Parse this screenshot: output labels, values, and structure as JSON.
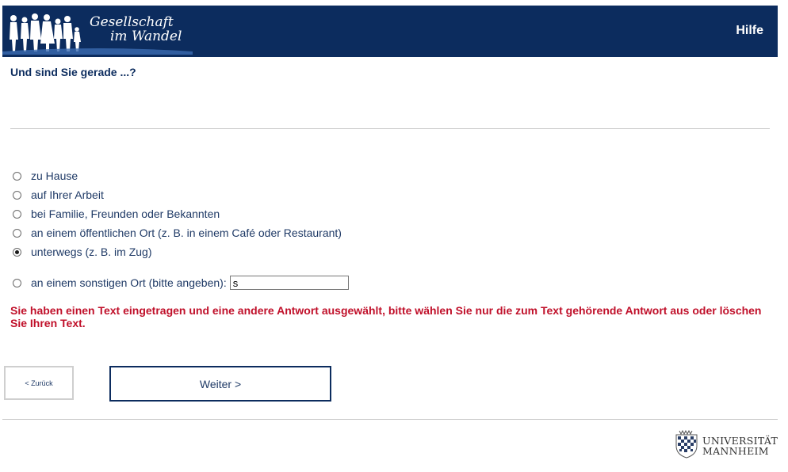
{
  "header": {
    "logo_line1": "Gesellschaft",
    "logo_line2": "im Wandel",
    "help_label": "Hilfe",
    "background_color": "#0c2c5e"
  },
  "question": {
    "text": "Und sind Sie gerade ...?"
  },
  "options": [
    {
      "label": "zu Hause",
      "checked": false
    },
    {
      "label": "auf Ihrer Arbeit",
      "checked": false
    },
    {
      "label": "bei Familie, Freunden oder Bekannten",
      "checked": false
    },
    {
      "label": "an einem öffentlichen Ort (z. B. in einem Café oder Restaurant)",
      "checked": false
    },
    {
      "label": "unterwegs (z. B. im Zug)",
      "checked": true
    },
    {
      "label": "an einem sonstigen Ort (bitte angeben):",
      "checked": false,
      "input_value": "s"
    }
  ],
  "error_message": "Sie haben einen Text eingetragen und eine andere Antwort ausgewählt, bitte wählen Sie nur die zum Text gehörende Antwort aus oder löschen Sie Ihren Text.",
  "error_color": "#c0102a",
  "navigation": {
    "back_label": "< Zurück",
    "next_label": "Weiter >"
  },
  "footer": {
    "university_line1": "UNIVERSITÄT",
    "university_line2": "MANNHEIM",
    "crest_icon": "university-crest-icon"
  }
}
